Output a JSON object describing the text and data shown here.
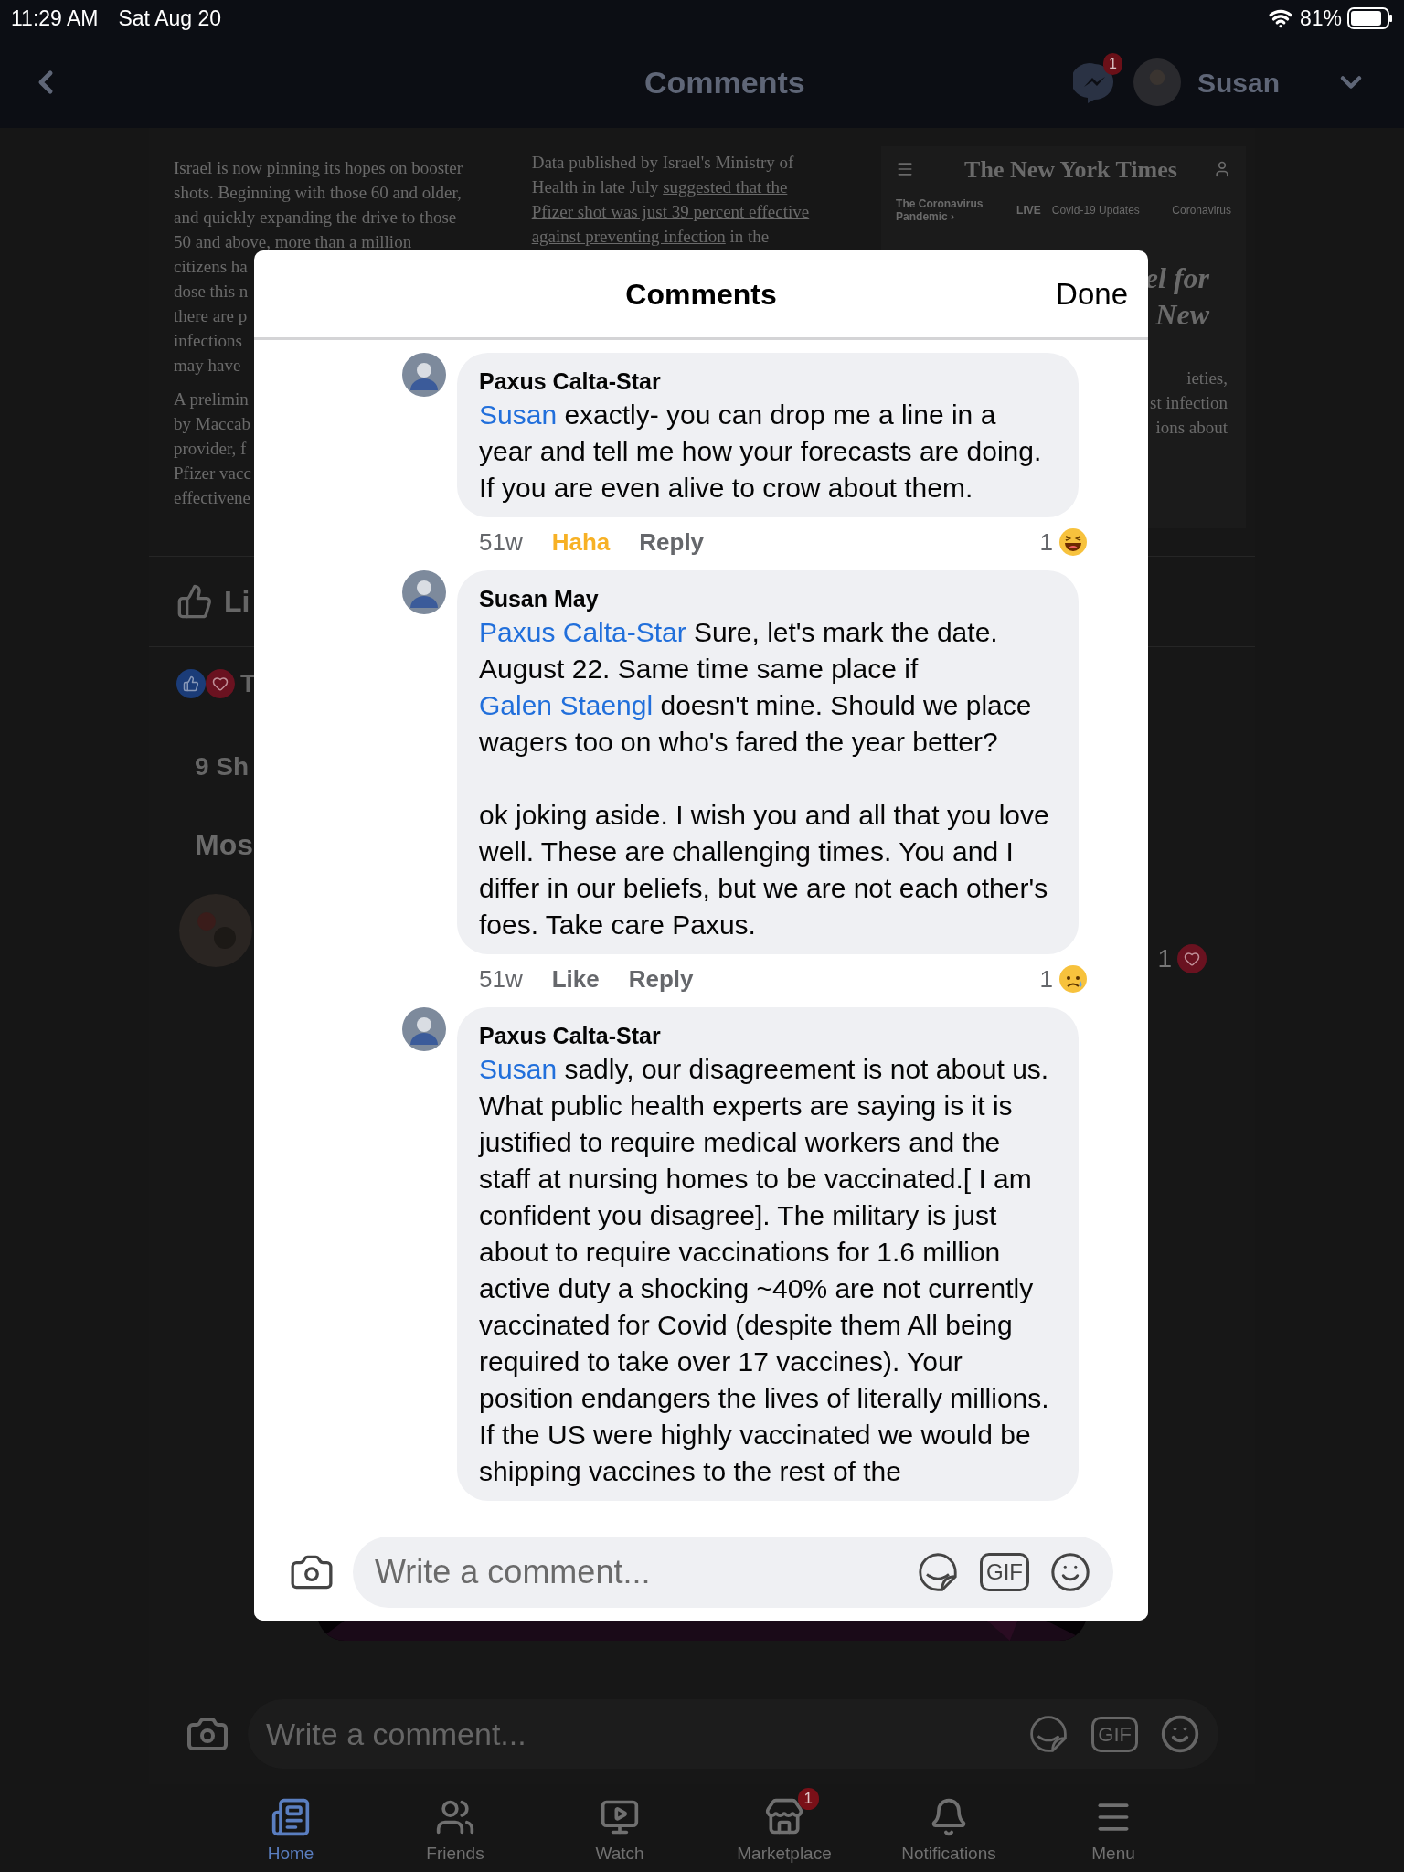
{
  "status_bar": {
    "time": "11:29 AM",
    "date": "Sat Aug 20",
    "battery": "81%"
  },
  "nav": {
    "title": "Comments",
    "messenger_badge": "1",
    "user": "Susan"
  },
  "article": {
    "left_column": [
      [
        "Israel is now pinning its hopes on booster",
        "shots. Beginning with those 60 and older,",
        "and quickly expanding the drive to those",
        "50 and above, more than a million",
        "citizens ha",
        "dose this n",
        "there are p",
        "infections",
        "may have"
      ],
      [
        "A prelimin",
        "by Maccab",
        "provider, f",
        "Pfizer vacc",
        "effectivene"
      ]
    ],
    "middle_column": [
      [
        {
          "text": "Data published by Israel's Ministry of",
          "link": false
        }
      ],
      [
        {
          "text": "Health in late July ",
          "link": false
        },
        {
          "text": "suggested that the",
          "link": true
        }
      ],
      [
        {
          "text": "Pfizer shot was just 39 percent effective",
          "link": true
        }
      ],
      [
        {
          "text": "against preventing infection",
          "link": true
        },
        {
          "text": " in the",
          "link": false
        }
      ]
    ],
    "nyt": {
      "logo": "The New York Times",
      "section": "The Coronavirus Pandemic ›",
      "live": "LIVE",
      "live_link": "Covid-19 Updates",
      "tab": "Coronavirus",
      "headline": [
        "el for",
        "New"
      ],
      "body": [
        "ieties,",
        "st infection",
        "ions about"
      ]
    }
  },
  "post": {
    "like": "Li",
    "reactions": "T",
    "shares": "9 Sh",
    "most": "Mos",
    "right_count": "1"
  },
  "bg_comment_bar": {
    "placeholder": "Write a comment...",
    "gif": "GIF"
  },
  "tab_bar": [
    {
      "label": "Home",
      "selected": true
    },
    {
      "label": "Friends",
      "selected": false
    },
    {
      "label": "Watch",
      "selected": false
    },
    {
      "label": "Marketplace",
      "selected": false,
      "badge": "1"
    },
    {
      "label": "Notifications",
      "selected": false
    },
    {
      "label": "Menu",
      "selected": false
    }
  ],
  "modal": {
    "title": "Comments",
    "done": "Done",
    "comments": [
      {
        "author": "Paxus Calta-Star",
        "paragraphs": [
          [
            {
              "text": "Susan",
              "mention": true
            },
            {
              "text": " exactly- you can drop me a line in a year and tell me how your forecasts are doing. If you are even alive to crow about them.",
              "mention": false
            }
          ]
        ],
        "time": "51w",
        "reaction_label": "Haha",
        "reacted": true,
        "reply": "Reply",
        "count": "1",
        "kind": "haha"
      },
      {
        "author": "Susan May",
        "paragraphs": [
          [
            {
              "text": "Paxus Calta-Star",
              "mention": true
            },
            {
              "text": " Sure, let's mark the date. August 22. Same time same place if ",
              "mention": false
            },
            {
              "text": "Galen Staengl",
              "mention": true
            },
            {
              "text": " doesn't mine. Should we place wagers too on who's fared the year better?",
              "mention": false
            }
          ],
          [
            {
              "text": "ok joking aside. I wish you and all that you love well. These are challenging times. You and I differ in our beliefs, but we are not each other's foes. Take care Paxus.",
              "mention": false
            }
          ]
        ],
        "time": "51w",
        "reaction_label": "Like",
        "reacted": false,
        "reply": "Reply",
        "count": "1",
        "kind": "sad"
      },
      {
        "author": "Paxus Calta-Star",
        "paragraphs": [
          [
            {
              "text": "Susan",
              "mention": true
            },
            {
              "text": " sadly, our disagreement is not about us.  What public health experts are saying is it is justified to require medical workers and the staff at nursing homes to be vaccinated.[ I am confident you disagree]. The military is just about to require vaccinations for 1.6 million active duty a shocking ~40% are not currently vaccinated for Covid (despite them All being required to take over 17 vaccines). Your position endangers the lives of literally millions.  If the US were highly vaccinated we would be shipping vaccines to the rest of the",
              "mention": false
            }
          ]
        ]
      }
    ],
    "composer": {
      "placeholder": "Write a comment...",
      "gif": "GIF"
    }
  }
}
